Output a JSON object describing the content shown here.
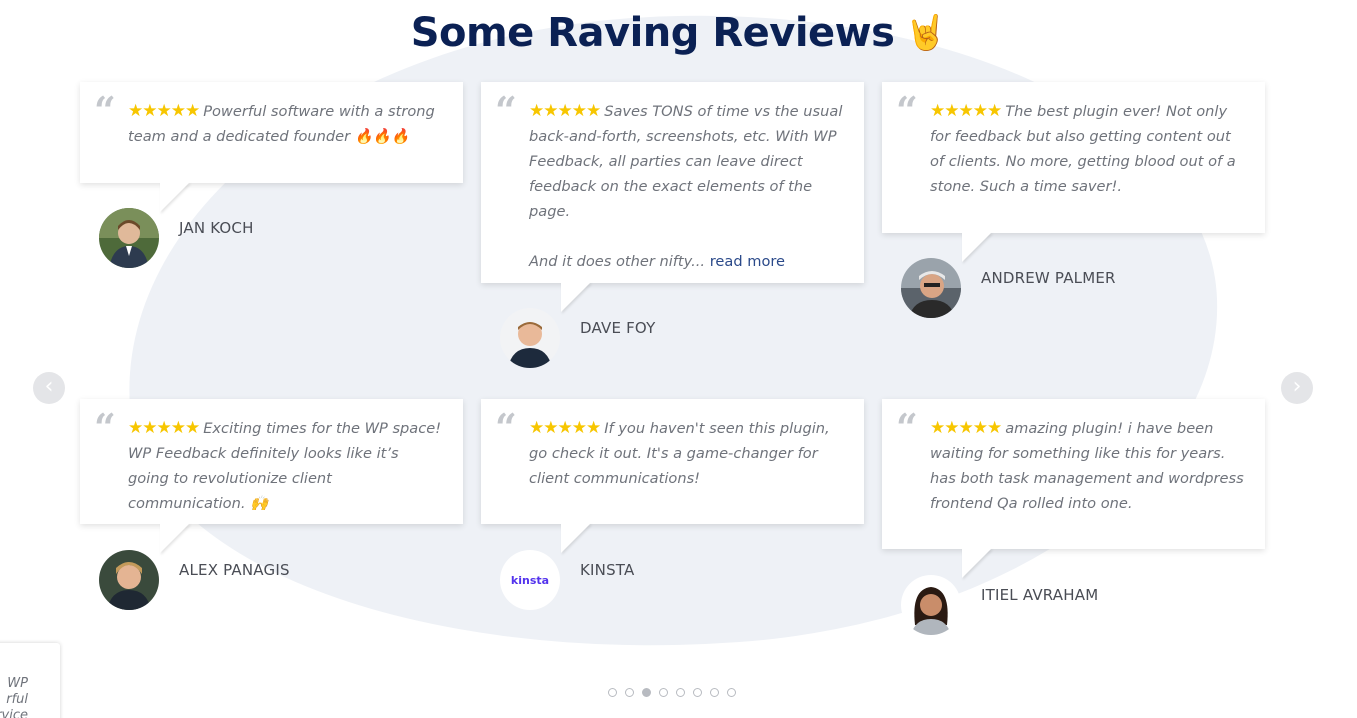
{
  "section": {
    "title": "Some Raving Reviews",
    "title_emoji": "🤘"
  },
  "stars": "★★★★★",
  "colors": {
    "title": "#0b2154",
    "star": "#f7c600",
    "blob": "#eef1f6",
    "link": "#2b4a8a"
  },
  "reviews": [
    {
      "text": "Powerful software with a strong team and a dedicated founder 🔥🔥🔥",
      "author": "JAN KOCH"
    },
    {
      "text": "Saves TONS of time vs the usual back-and-forth, screenshots, etc. With WP Feedback, all parties can leave direct feedback on the exact elements of the page.",
      "text2": "And it does other nifty...",
      "more": "read more",
      "author": "DAVE FOY"
    },
    {
      "text": "The best plugin ever! Not only for feedback but also getting content out of clients. No more, getting blood out of a stone. Such a time saver!.",
      "author": "ANDREW PALMER"
    },
    {
      "text": "Exciting times for the WP space! WP Feedback definitely looks like it’s going to revolutionize client communication. 🙌",
      "author": "ALEX PANAGIS"
    },
    {
      "text": "If you haven't seen this plugin, go check it out. It's a game-changer for client communications!",
      "author": "KINSTA",
      "logo_text": "kinsta"
    },
    {
      "text": "amazing plugin! i have been waiting for something like this for years. has both task management and wordpress frontend Qa rolled into one.",
      "author": "ITIEL AVRAHAM"
    }
  ],
  "nav": {
    "prev_icon": "chevron-left-icon",
    "next_icon": "chevron-right-icon",
    "prev_glyph": "‹",
    "next_glyph": "›"
  },
  "pagination": {
    "total": 8,
    "active_index": 2
  },
  "popup": {
    "line1": "WP",
    "line2": "rful",
    "line3": "ervice"
  }
}
